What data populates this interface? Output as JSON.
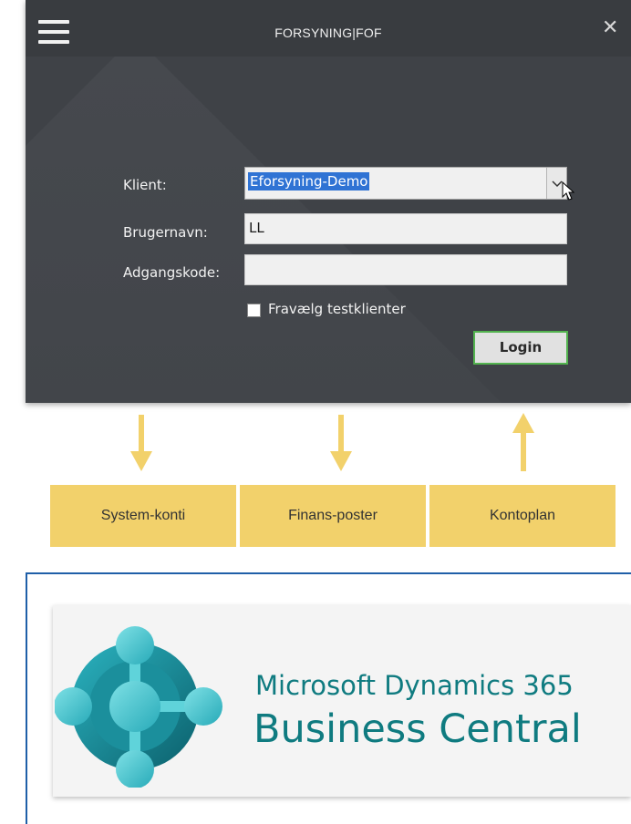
{
  "window": {
    "title": "FORSYNING|FOF",
    "client_label": "Klient:",
    "client_value": "Eforsyning-Demo",
    "username_label": "Brugernavn:",
    "username_value": "LL",
    "password_label": "Adgangskode:",
    "password_value": "",
    "deselect_test_label": "Fravælg testklienter",
    "deselect_test_checked": false,
    "login_label": "Login"
  },
  "flow": {
    "boxes": [
      {
        "label": "System-konti",
        "direction": "down"
      },
      {
        "label": "Finans-poster",
        "direction": "down"
      },
      {
        "label": "Kontoplan",
        "direction": "up"
      }
    ],
    "box_color": "#f2d16b",
    "arrow_color": "#f2d16b"
  },
  "product": {
    "line1": "Microsoft Dynamics 365",
    "line2": "Business Central",
    "text_color": "#0f7b80",
    "logo_icon": "business-central-logo"
  },
  "colors": {
    "window_bg": "#3f4247",
    "login_border": "#53b34f",
    "selection": "#2f73d4",
    "frame_border": "#1f5fa8"
  }
}
